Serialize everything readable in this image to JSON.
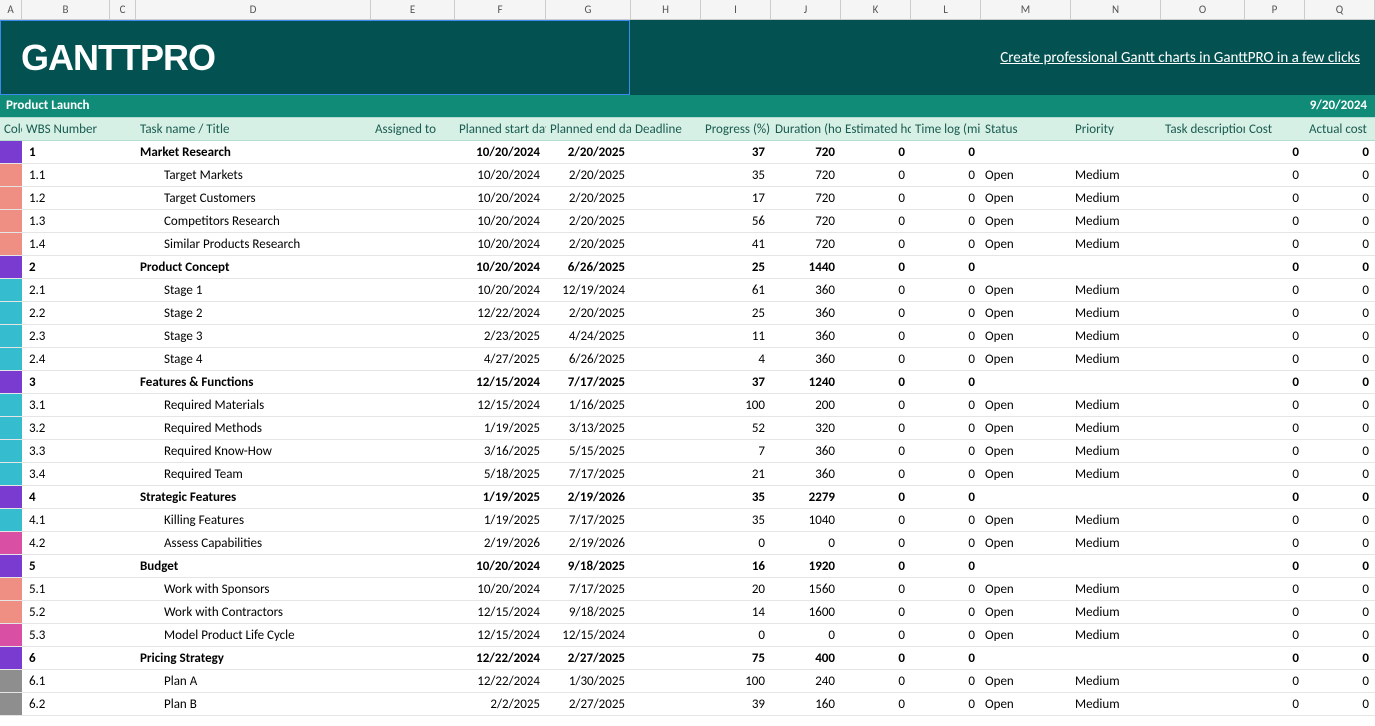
{
  "cols": [
    "A",
    "B",
    "C",
    "D",
    "E",
    "F",
    "G",
    "H",
    "I",
    "J",
    "K",
    "L",
    "M",
    "N",
    "O",
    "P",
    "Q"
  ],
  "widths": [
    22,
    88,
    26,
    235,
    84,
    91,
    85,
    70,
    70,
    70,
    70,
    70,
    90,
    90,
    84,
    60,
    70
  ],
  "logoText": "GANTTPRO",
  "bannerLink": "Create professional Gantt charts in GanttPRO in a few clicks",
  "projectName": "Product Launch",
  "projectDate": "9/20/2024",
  "headers": {
    "color": "Color",
    "wbs": "WBS Number",
    "blank": "",
    "task": "Task name / Title",
    "assigned": "Assigned to",
    "pstart": "Planned start date",
    "pend": "Planned end date",
    "deadline": "Deadline",
    "progress": "Progress (%)",
    "duration": "Duration  (hours)",
    "estimated": "Estimated hours",
    "timelog": "Time log (minutes)",
    "status": "Status",
    "priority": "Priority",
    "desc": "Task description",
    "cost": "Cost",
    "actual": "Actual cost"
  },
  "rows": [
    {
      "type": "parent",
      "color": "#7a3bd1",
      "wbs": "1",
      "task": "Market Research",
      "pstart": "10/20/2024",
      "pend": "2/20/2025",
      "progress": 37,
      "duration": 720,
      "est": 0,
      "tlog": 0,
      "status": "",
      "priority": "",
      "cost": 0,
      "actual": 0
    },
    {
      "type": "child",
      "color": "#ef8f84",
      "wbs": "1.1",
      "task": "Target Markets",
      "pstart": "10/20/2024",
      "pend": "2/20/2025",
      "progress": 35,
      "duration": 720,
      "est": 0,
      "tlog": 0,
      "status": "Open",
      "priority": "Medium",
      "cost": 0,
      "actual": 0
    },
    {
      "type": "child",
      "color": "#ef8f84",
      "wbs": "1.2",
      "task": "Target Customers",
      "pstart": "10/20/2024",
      "pend": "2/20/2025",
      "progress": 17,
      "duration": 720,
      "est": 0,
      "tlog": 0,
      "status": "Open",
      "priority": "Medium",
      "cost": 0,
      "actual": 0
    },
    {
      "type": "child",
      "color": "#ef8f84",
      "wbs": "1.3",
      "task": "Competitors Research",
      "pstart": "10/20/2024",
      "pend": "2/20/2025",
      "progress": 56,
      "duration": 720,
      "est": 0,
      "tlog": 0,
      "status": "Open",
      "priority": "Medium",
      "cost": 0,
      "actual": 0
    },
    {
      "type": "child",
      "color": "#ef8f84",
      "wbs": "1.4",
      "task": "Similar Products Research",
      "pstart": "10/20/2024",
      "pend": "2/20/2025",
      "progress": 41,
      "duration": 720,
      "est": 0,
      "tlog": 0,
      "status": "Open",
      "priority": "Medium",
      "cost": 0,
      "actual": 0
    },
    {
      "type": "parent",
      "color": "#7a3bd1",
      "wbs": "2",
      "task": "Product Concept",
      "pstart": "10/20/2024",
      "pend": "6/26/2025",
      "progress": 25,
      "duration": 1440,
      "est": 0,
      "tlog": 0,
      "status": "",
      "priority": "",
      "cost": 0,
      "actual": 0
    },
    {
      "type": "child",
      "color": "#35bccf",
      "wbs": "2.1",
      "task": "Stage 1",
      "pstart": "10/20/2024",
      "pend": "12/19/2024",
      "progress": 61,
      "duration": 360,
      "est": 0,
      "tlog": 0,
      "status": "Open",
      "priority": "Medium",
      "cost": 0,
      "actual": 0
    },
    {
      "type": "child",
      "color": "#35bccf",
      "wbs": "2.2",
      "task": "Stage 2",
      "pstart": "12/22/2024",
      "pend": "2/20/2025",
      "progress": 25,
      "duration": 360,
      "est": 0,
      "tlog": 0,
      "status": "Open",
      "priority": "Medium",
      "cost": 0,
      "actual": 0
    },
    {
      "type": "child",
      "color": "#35bccf",
      "wbs": "2.3",
      "task": "Stage 3",
      "pstart": "2/23/2025",
      "pend": "4/24/2025",
      "progress": 11,
      "duration": 360,
      "est": 0,
      "tlog": 0,
      "status": "Open",
      "priority": "Medium",
      "cost": 0,
      "actual": 0
    },
    {
      "type": "child",
      "color": "#35bccf",
      "wbs": "2.4",
      "task": "Stage 4",
      "pstart": "4/27/2025",
      "pend": "6/26/2025",
      "progress": 4,
      "duration": 360,
      "est": 0,
      "tlog": 0,
      "status": "Open",
      "priority": "Medium",
      "cost": 0,
      "actual": 0
    },
    {
      "type": "parent",
      "color": "#7a3bd1",
      "wbs": "3",
      "task": "Features & Functions",
      "pstart": "12/15/2024",
      "pend": "7/17/2025",
      "progress": 37,
      "duration": 1240,
      "est": 0,
      "tlog": 0,
      "status": "",
      "priority": "",
      "cost": 0,
      "actual": 0
    },
    {
      "type": "child",
      "color": "#35bccf",
      "wbs": "3.1",
      "task": "Required Materials",
      "pstart": "12/15/2024",
      "pend": "1/16/2025",
      "progress": 100,
      "duration": 200,
      "est": 0,
      "tlog": 0,
      "status": "Open",
      "priority": "Medium",
      "cost": 0,
      "actual": 0
    },
    {
      "type": "child",
      "color": "#35bccf",
      "wbs": "3.2",
      "task": "Required Methods",
      "pstart": "1/19/2025",
      "pend": "3/13/2025",
      "progress": 52,
      "duration": 320,
      "est": 0,
      "tlog": 0,
      "status": "Open",
      "priority": "Medium",
      "cost": 0,
      "actual": 0
    },
    {
      "type": "child",
      "color": "#35bccf",
      "wbs": "3.3",
      "task": "Required Know-How",
      "pstart": "3/16/2025",
      "pend": "5/15/2025",
      "progress": 7,
      "duration": 360,
      "est": 0,
      "tlog": 0,
      "status": "Open",
      "priority": "Medium",
      "cost": 0,
      "actual": 0
    },
    {
      "type": "child",
      "color": "#35bccf",
      "wbs": "3.4",
      "task": "Required Team",
      "pstart": "5/18/2025",
      "pend": "7/17/2025",
      "progress": 21,
      "duration": 360,
      "est": 0,
      "tlog": 0,
      "status": "Open",
      "priority": "Medium",
      "cost": 0,
      "actual": 0
    },
    {
      "type": "parent",
      "color": "#7a3bd1",
      "wbs": "4",
      "task": "Strategic Features",
      "pstart": "1/19/2025",
      "pend": "2/19/2026",
      "progress": 35,
      "duration": 2279,
      "est": 0,
      "tlog": 0,
      "status": "",
      "priority": "",
      "cost": 0,
      "actual": 0
    },
    {
      "type": "child",
      "color": "#35bccf",
      "wbs": "4.1",
      "task": "Killing Features",
      "pstart": "1/19/2025",
      "pend": "7/17/2025",
      "progress": 35,
      "duration": 1040,
      "est": 0,
      "tlog": 0,
      "status": "Open",
      "priority": "Medium",
      "cost": 0,
      "actual": 0
    },
    {
      "type": "child",
      "color": "#d94fa3",
      "wbs": "4.2",
      "task": "Assess Capabilities",
      "pstart": "2/19/2026",
      "pend": "2/19/2026",
      "progress": 0,
      "duration": 0,
      "est": 0,
      "tlog": 0,
      "status": "Open",
      "priority": "Medium",
      "cost": 0,
      "actual": 0
    },
    {
      "type": "parent",
      "color": "#7a3bd1",
      "wbs": "5",
      "task": "Budget",
      "pstart": "10/20/2024",
      "pend": "9/18/2025",
      "progress": 16,
      "duration": 1920,
      "est": 0,
      "tlog": 0,
      "status": "",
      "priority": "",
      "cost": 0,
      "actual": 0
    },
    {
      "type": "child",
      "color": "#ef8f84",
      "wbs": "5.1",
      "task": "Work with Sponsors",
      "pstart": "10/20/2024",
      "pend": "7/17/2025",
      "progress": 20,
      "duration": 1560,
      "est": 0,
      "tlog": 0,
      "status": "Open",
      "priority": "Medium",
      "cost": 0,
      "actual": 0
    },
    {
      "type": "child",
      "color": "#ef8f84",
      "wbs": "5.2",
      "task": "Work with Contractors",
      "pstart": "12/15/2024",
      "pend": "9/18/2025",
      "progress": 14,
      "duration": 1600,
      "est": 0,
      "tlog": 0,
      "status": "Open",
      "priority": "Medium",
      "cost": 0,
      "actual": 0
    },
    {
      "type": "child",
      "color": "#d94fa3",
      "wbs": "5.3",
      "task": "Model Product Life Cycle",
      "pstart": "12/15/2024",
      "pend": "12/15/2024",
      "progress": 0,
      "duration": 0,
      "est": 0,
      "tlog": 0,
      "status": "Open",
      "priority": "Medium",
      "cost": 0,
      "actual": 0
    },
    {
      "type": "parent",
      "color": "#7a3bd1",
      "wbs": "6",
      "task": "Pricing Strategy",
      "pstart": "12/22/2024",
      "pend": "2/27/2025",
      "progress": 75,
      "duration": 400,
      "est": 0,
      "tlog": 0,
      "status": "",
      "priority": "",
      "cost": 0,
      "actual": 0
    },
    {
      "type": "child",
      "color": "#8e8e8e",
      "wbs": "6.1",
      "task": "Plan A",
      "pstart": "12/22/2024",
      "pend": "1/30/2025",
      "progress": 100,
      "duration": 240,
      "est": 0,
      "tlog": 0,
      "status": "Open",
      "priority": "Medium",
      "cost": 0,
      "actual": 0
    },
    {
      "type": "child",
      "color": "#8e8e8e",
      "wbs": "6.2",
      "task": "Plan B",
      "pstart": "2/2/2025",
      "pend": "2/27/2025",
      "progress": 39,
      "duration": 160,
      "est": 0,
      "tlog": 0,
      "status": "Open",
      "priority": "Medium",
      "cost": 0,
      "actual": 0
    }
  ]
}
